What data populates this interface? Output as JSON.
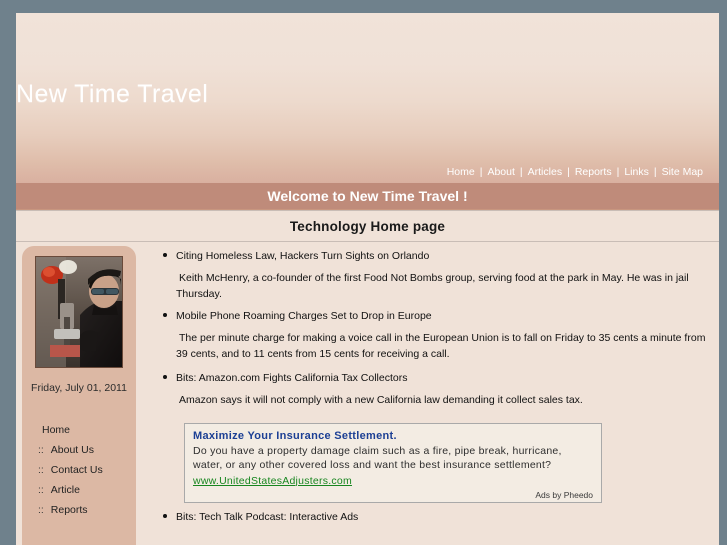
{
  "site": {
    "title": "New Time Travel",
    "welcome_banner": "Welcome to New Time Travel !",
    "page_subtitle": "Technology Home page"
  },
  "topnav": {
    "separator": "|",
    "items": [
      {
        "label": "Home"
      },
      {
        "label": "About"
      },
      {
        "label": "Articles"
      },
      {
        "label": "Reports"
      },
      {
        "label": "Links"
      },
      {
        "label": "Site Map"
      }
    ]
  },
  "sidebar": {
    "photo_alt": "workshop-photo",
    "date": "Friday, July 01, 2011",
    "items": [
      {
        "label": "Home",
        "prefix": ""
      },
      {
        "label": "About Us",
        "prefix": ":: "
      },
      {
        "label": "Contact Us",
        "prefix": ":: "
      },
      {
        "label": "Article",
        "prefix": ":: "
      },
      {
        "label": "Reports",
        "prefix": ":: "
      }
    ]
  },
  "main": {
    "articles": [
      {
        "title": "Citing Homeless Law, Hackers Turn Sights on Orlando",
        "body": "Keith McHenry, a co-founder of the first Food Not Bombs group, serving food at the park in May. He was in jail Thursday."
      },
      {
        "title": "Mobile Phone Roaming Charges Set to Drop in Europe",
        "body": "The per minute charge for making a voice call in the European Union is to fall on Friday to 35 cents a minute from 39 cents, and to 11 cents from 15 cents for receiving a call."
      },
      {
        "title": "Bits: Amazon.com Fights California Tax Collectors",
        "body": "Amazon says it will not comply with a new California law demanding it collect sales tax."
      }
    ],
    "partial_article": {
      "title": "Bits: Tech Talk Podcast: Interactive Ads"
    }
  },
  "ad": {
    "headline": "Maximize Your Insurance Settlement.",
    "body": "Do you have a property damage claim such as a fire, pipe break, hurricane, water, or any other covered loss and want the best insurance settlement?",
    "link": "www.UnitedStatesAdjusters.com",
    "credit": "Ads by Pheedo"
  },
  "colors": {
    "frame": "#6f818c",
    "page_bg": "#f0e2d8",
    "banner": "#bf8b7a",
    "sidebar": "#dcb8a4",
    "ad_headline": "#1c3f94",
    "ad_link": "#17861f"
  }
}
